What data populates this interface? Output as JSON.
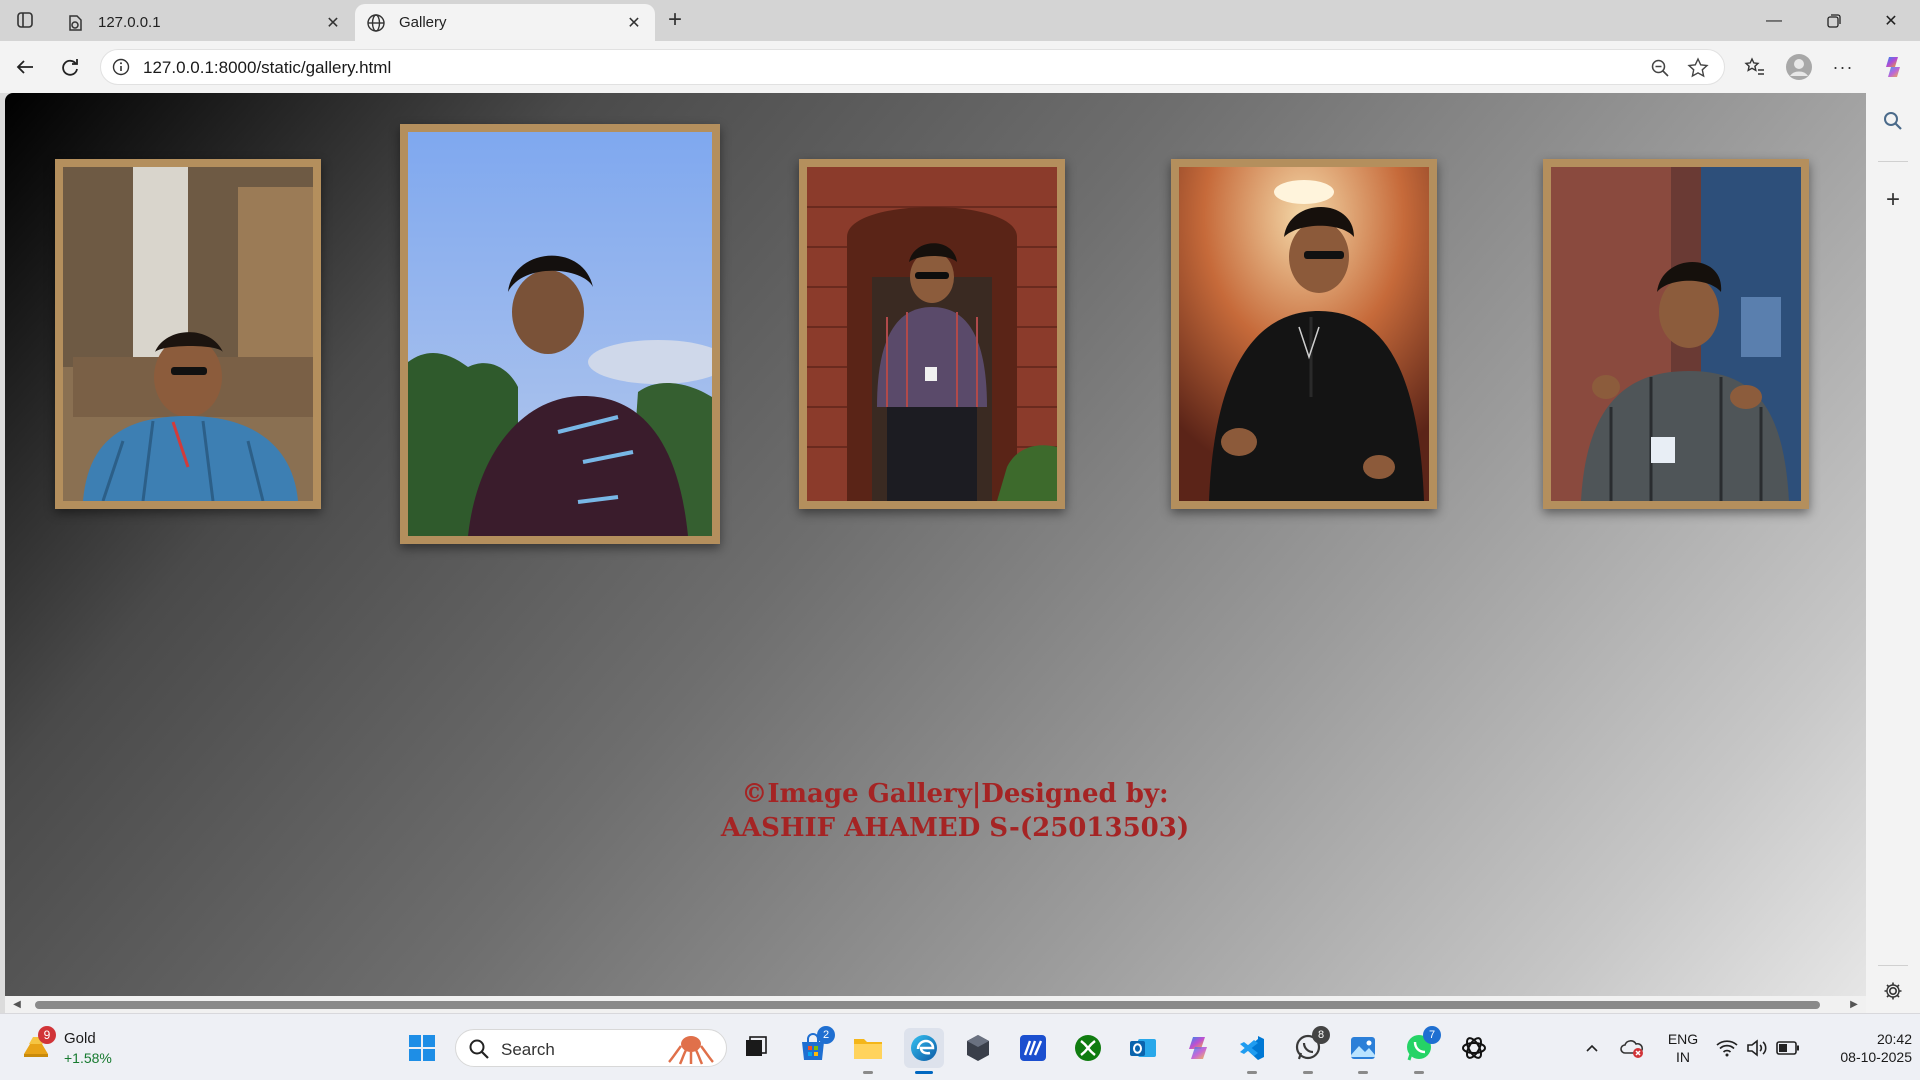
{
  "browser": {
    "tabs": [
      {
        "title": "127.0.0.1",
        "icon": "page-reload-icon",
        "active": false
      },
      {
        "title": "Gallery",
        "icon": "globe-icon",
        "active": true
      }
    ],
    "address": {
      "url": "127.0.0.1:8000/static/gallery.html"
    }
  },
  "page": {
    "photos": [
      {
        "alt": "photo-1",
        "subject": "man in blue check shirt with sunglasses"
      },
      {
        "alt": "photo-2",
        "subject": "young man in maroon sweater against blue sky"
      },
      {
        "alt": "photo-3",
        "subject": "man in plaid shirt in front of brick doorway"
      },
      {
        "alt": "photo-4",
        "subject": "man in black shirt with sunglasses"
      },
      {
        "alt": "photo-5",
        "subject": "smiling man in checked shirt pointing"
      }
    ],
    "footer_line1": "©Image Gallery|Designed by:",
    "footer_line2": "AASHIF AHAMED S-(25013503)",
    "frame_color": "#b48f5d",
    "footer_color": "#a52424"
  },
  "taskbar": {
    "widget": {
      "badge": "9",
      "title": "Gold",
      "change": "+1.58%"
    },
    "search_placeholder": "Search",
    "badges": {
      "store": "2",
      "whatsapp_beta": "8",
      "whatsapp": "7"
    },
    "language_line1": "ENG",
    "language_line2": "IN",
    "time": "20:42",
    "date": "08-10-2025"
  }
}
